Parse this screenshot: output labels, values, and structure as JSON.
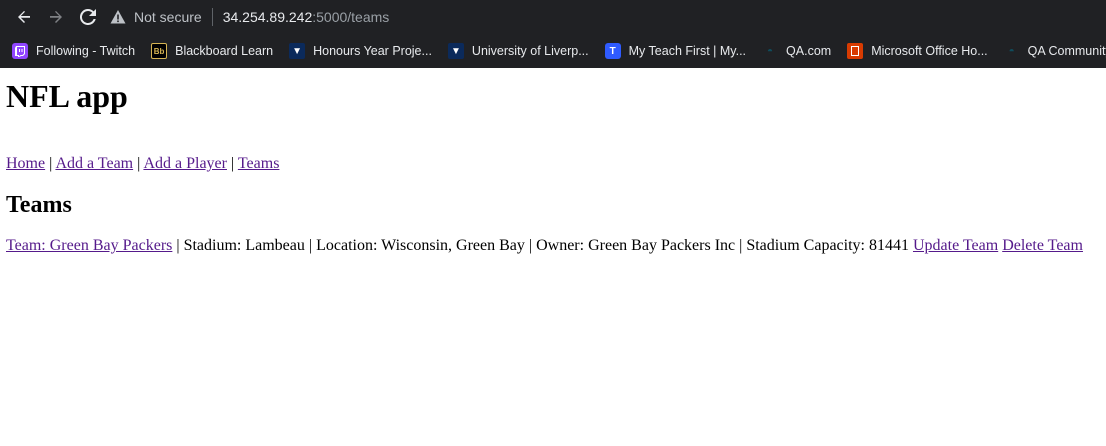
{
  "browser": {
    "not_secure": "Not secure",
    "url_host": "34.254.89.242",
    "url_rest": ":5000/teams",
    "bookmarks": [
      {
        "label": "Following - Twitch",
        "icon": "twitch-icon"
      },
      {
        "label": "Blackboard Learn",
        "icon": "blackboard-icon"
      },
      {
        "label": "Honours Year Proje...",
        "icon": "liverpool-crest-icon"
      },
      {
        "label": "University of Liverp...",
        "icon": "liverpool-crest-icon"
      },
      {
        "label": "My Teach First | My...",
        "icon": "teachfirst-icon"
      },
      {
        "label": "QA.com",
        "icon": "qa-icon"
      },
      {
        "label": "Microsoft Office Ho...",
        "icon": "office-icon"
      },
      {
        "label": "QA Community",
        "icon": "qa-icon"
      }
    ],
    "icon_glyphs": {
      "blackboard": "Bb",
      "teachfirst": "T",
      "liverpool": "▼",
      "qa": "◓"
    }
  },
  "page": {
    "title": "NFL app",
    "nav": {
      "home": "Home",
      "add_team": "Add a Team",
      "add_player": "Add a Player",
      "teams": "Teams",
      "separator": " | "
    },
    "heading": "Teams",
    "team": {
      "name_link": "Team: Green Bay Packers",
      "stadium": "Stadium: Lambeau",
      "location": "Location: Wisconsin, Green Bay",
      "owner": "Owner: Green Bay Packers Inc",
      "capacity": "Stadium Capacity: 81441",
      "update_link": "Update Team",
      "delete_link": "Delete Team"
    }
  },
  "colors": {
    "chrome_bg": "#202124",
    "link_visited": "#551a8b"
  }
}
